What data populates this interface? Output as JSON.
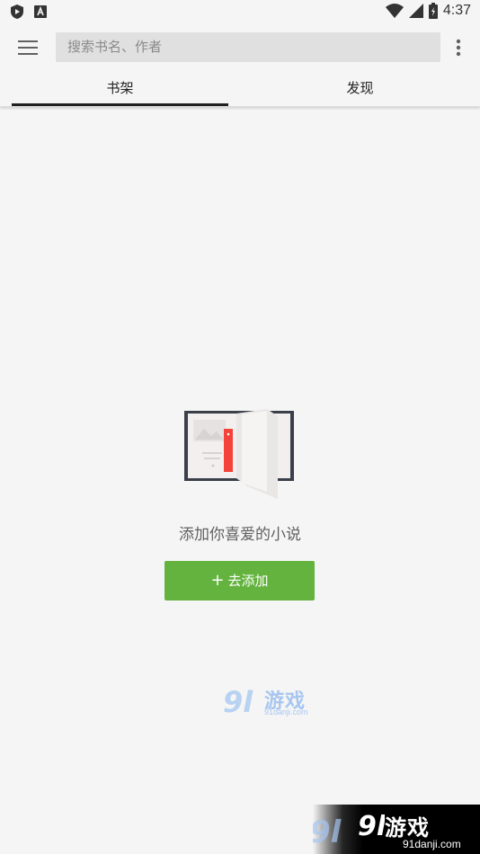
{
  "status_bar": {
    "time": "4:37",
    "icons": [
      "shield-app-icon",
      "font-app-icon",
      "wifi-icon",
      "cell-signal-icon",
      "battery-charging-icon"
    ]
  },
  "toolbar": {
    "search_placeholder": "搜索书名、作者",
    "menu_icon": "hamburger-menu-icon",
    "more_icon": "more-vert-icon"
  },
  "tabs": [
    {
      "label": "书架",
      "active": true
    },
    {
      "label": "发现",
      "active": false
    }
  ],
  "empty_state": {
    "message": "添加你喜爱的小说",
    "button_label": "去添加",
    "button_icon": "plus-icon"
  },
  "colors": {
    "background": "#f5f5f5",
    "accent_green": "#63b33e",
    "search_bg": "#e0e0e0",
    "bookmark_red": "#f4433a"
  },
  "watermark": {
    "center_brand": "游戏",
    "center_url": "91danji.com",
    "corner_brand": "游戏",
    "corner_url": "91danji.com"
  }
}
